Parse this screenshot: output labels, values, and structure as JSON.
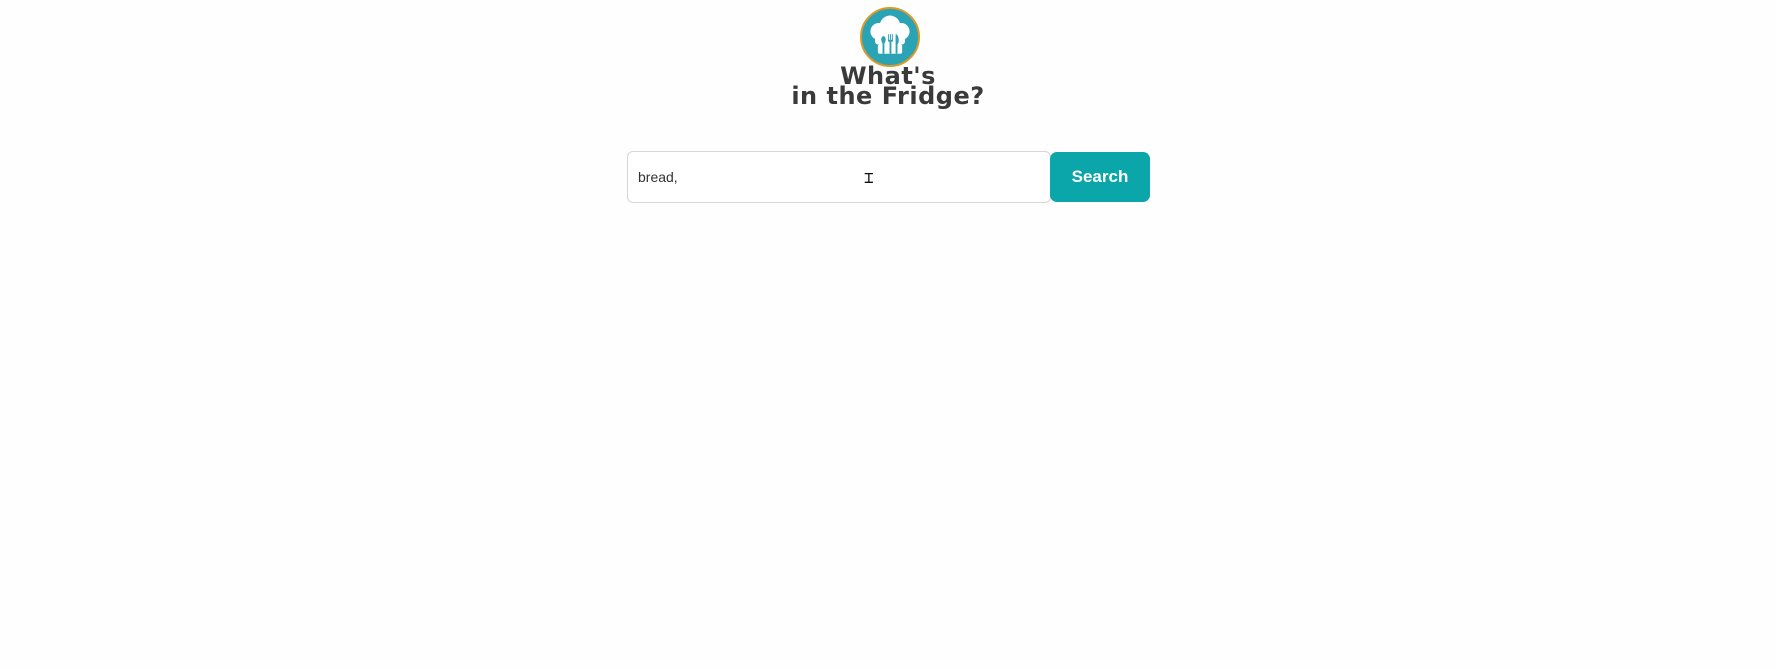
{
  "header": {
    "title_line1": "What's",
    "title_line2": "in the Fridge?",
    "logo_icon": "chef-hat-utensils-icon"
  },
  "search": {
    "value": "bread, ",
    "button_label": "Search"
  },
  "colors": {
    "accent": "#0aa6a9",
    "logo_bg": "#2aa3b4",
    "logo_ring": "#d99a2b",
    "title_text": "#3a3a3a"
  }
}
